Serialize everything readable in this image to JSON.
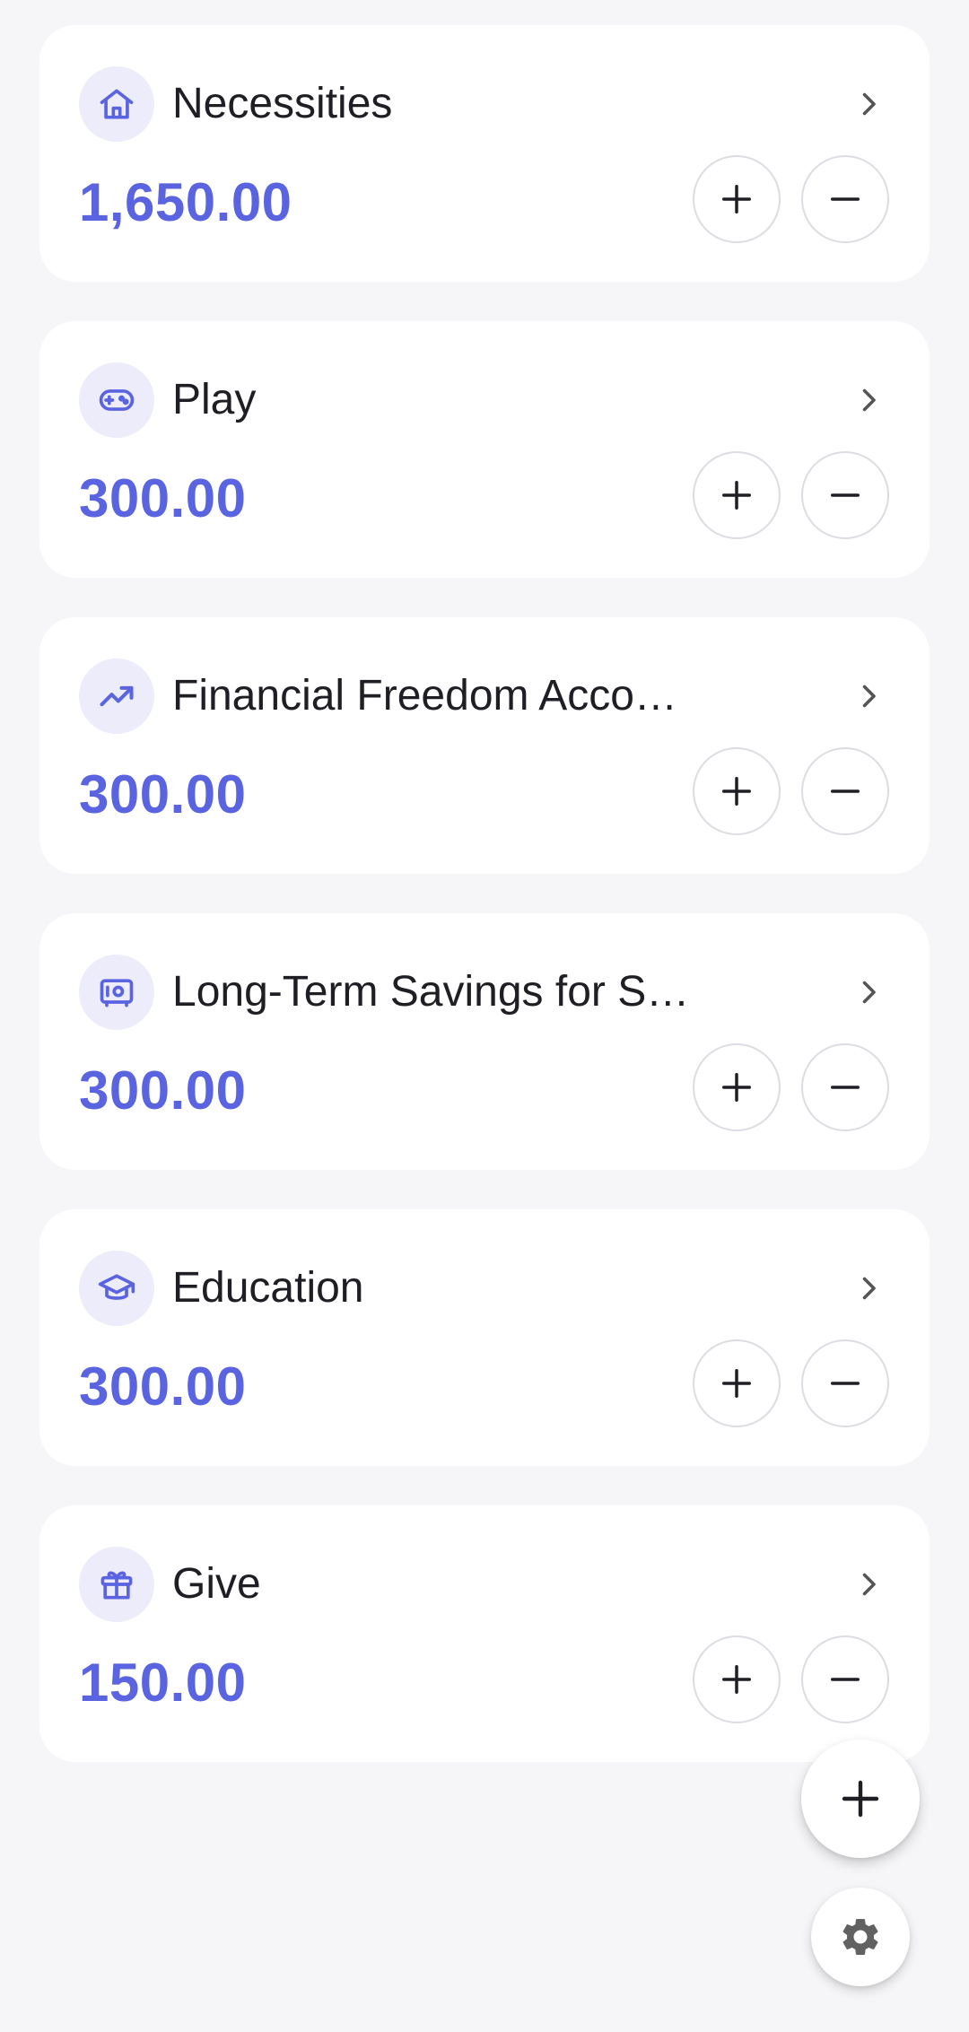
{
  "colors": {
    "accent": "#5b64e0",
    "icon_bg": "#ececfb",
    "background": "#f6f6f9",
    "card": "#ffffff",
    "text": "#1e1e24"
  },
  "accounts": [
    {
      "title": "Necessities",
      "amount": "1,650.00",
      "icon": "home-icon"
    },
    {
      "title": "Play",
      "amount": "300.00",
      "icon": "gamepad-icon"
    },
    {
      "title": "Financial Freedom Acco…",
      "amount": "300.00",
      "icon": "trending-up-icon"
    },
    {
      "title": "Long-Term Savings for S…",
      "amount": "300.00",
      "icon": "safe-icon"
    },
    {
      "title": "Education",
      "amount": "300.00",
      "icon": "graduation-cap-icon"
    },
    {
      "title": "Give",
      "amount": "150.00",
      "icon": "gift-icon"
    }
  ],
  "actions": {
    "add_account_icon": "plus-icon",
    "settings_icon": "gear-icon"
  }
}
